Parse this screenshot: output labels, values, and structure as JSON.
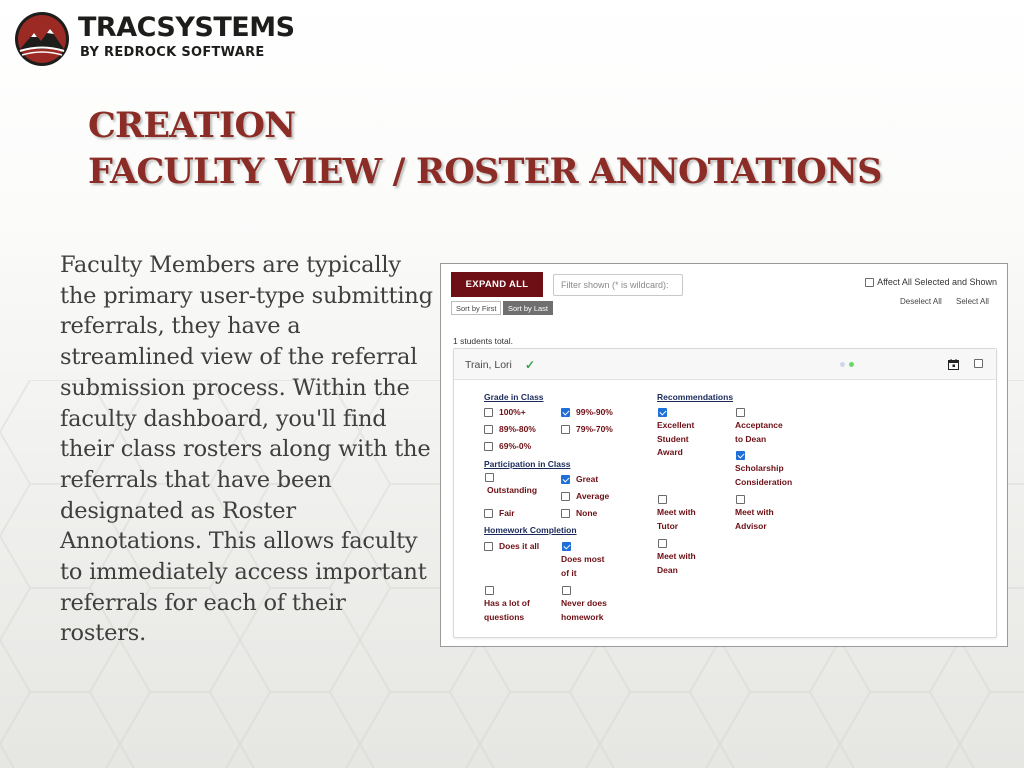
{
  "brand": {
    "name_line1": "TRACSYSTEMS",
    "name_line2": "BY REDROCK SOFTWARE"
  },
  "title": {
    "line1": "CREATION",
    "line2": "FACULTY VIEW / ROSTER ANNOTATIONS"
  },
  "body_text": "Faculty Members are typically the primary user-type submitting referrals, they have a streamlined view of the referral submission process. Within the faculty dashboard, you'll find their class rosters along with the referrals that have been designated as Roster Annotations. This allows faculty to immediately access important referrals for each of their rosters.",
  "screenshot": {
    "expand_all_label": "EXPAND ALL",
    "filter_placeholder": "Filter shown (* is wildcard):",
    "sort_first_label": "Sort by First",
    "sort_last_label": "Sort by Last",
    "affect_all_label": "Affect All Selected and Shown",
    "deselect_all_label": "Deselect All",
    "select_all_label": "Select All",
    "student_count": "1 students total.",
    "student": {
      "name": "Train, Lori",
      "check_icon": "checkmark-icon"
    },
    "grade_in_class": {
      "heading": "Grade in Class",
      "opt_100": {
        "label": "100%+",
        "checked": false
      },
      "opt_99_90": {
        "label": "99%-90%",
        "checked": true
      },
      "opt_89_80": {
        "label": "89%-80%",
        "checked": false
      },
      "opt_79_70": {
        "label": "79%-70%",
        "checked": false
      },
      "opt_69_0": {
        "label": "69%-0%",
        "checked": false
      }
    },
    "participation": {
      "heading": "Participation in Class",
      "outstanding": {
        "label": "Outstanding",
        "checked": false
      },
      "great": {
        "label": "Great",
        "checked": true
      },
      "average": {
        "label": "Average",
        "checked": false
      },
      "fair": {
        "label": "Fair",
        "checked": false
      },
      "none": {
        "label": "None",
        "checked": false
      }
    },
    "homework": {
      "heading": "Homework Completion",
      "does_it_all": {
        "label": "Does it all",
        "checked": false
      },
      "does_most_1": "Does most",
      "does_most_2": "of it",
      "has_questions_1": "Has a lot of",
      "has_questions_2": "questions",
      "never_1": "Never does",
      "never_2": "homework"
    },
    "recommendations": {
      "heading": "Recommendations",
      "excellent_1": "Excellent",
      "excellent_2": "Student",
      "excellent_3": "Award",
      "acceptance_1": "Acceptance",
      "acceptance_2": "to Dean",
      "scholarship_1": "Scholarship",
      "scholarship_2": "Consideration",
      "tutor_1": "Meet with",
      "tutor_2": "Tutor",
      "advisor_1": "Meet with",
      "advisor_2": "Advisor",
      "dean_1": "Meet with",
      "dean_2": "Dean"
    }
  },
  "colors": {
    "title": "#8b2d26",
    "expand_button": "#6e0f15",
    "option_text": "#6e0f15",
    "section_heading": "#1b2a5a",
    "checkbox_checked": "#1f6fd8"
  }
}
